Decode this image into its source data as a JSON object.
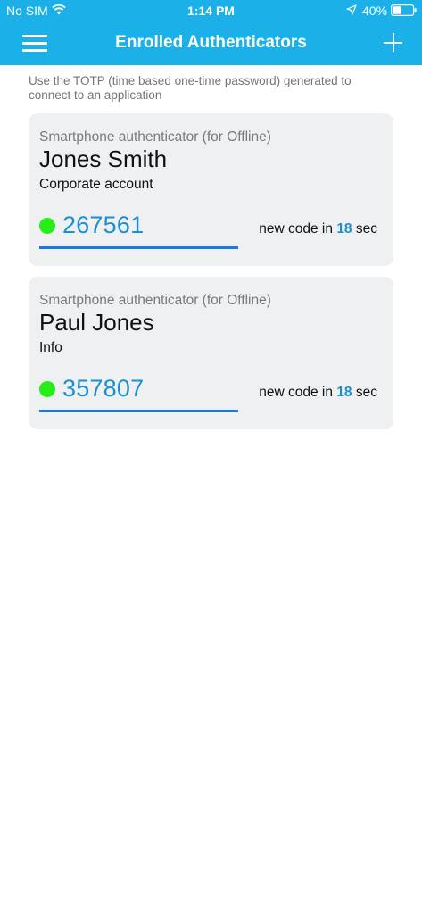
{
  "status_bar": {
    "carrier": "No SIM",
    "time": "1:14 PM",
    "battery": "40%"
  },
  "nav": {
    "title": "Enrolled Authenticators",
    "icons": [
      "hamburger-menu-icon",
      "plus-icon"
    ]
  },
  "intro": "Use the TOTP (time based one-time password) generated to connect to an application",
  "colors": {
    "header": "#1BB0E8",
    "card_bg": "#EEF0F1",
    "code": "#1A90D0",
    "underline": "#1A78E2",
    "status_dot": "#27EE1A"
  },
  "authenticators": [
    {
      "type": "Smartphone authenticator (for Offline)",
      "name": "Jones Smith",
      "account": "Corporate account",
      "code": "267561",
      "countdown_prefix": "new code in",
      "seconds": "18",
      "countdown_suffix": "sec"
    },
    {
      "type": "Smartphone authenticator (for Offline)",
      "name": "Paul Jones",
      "account": "Info",
      "code": "357807",
      "countdown_prefix": "new code in",
      "seconds": "18",
      "countdown_suffix": "sec"
    }
  ]
}
